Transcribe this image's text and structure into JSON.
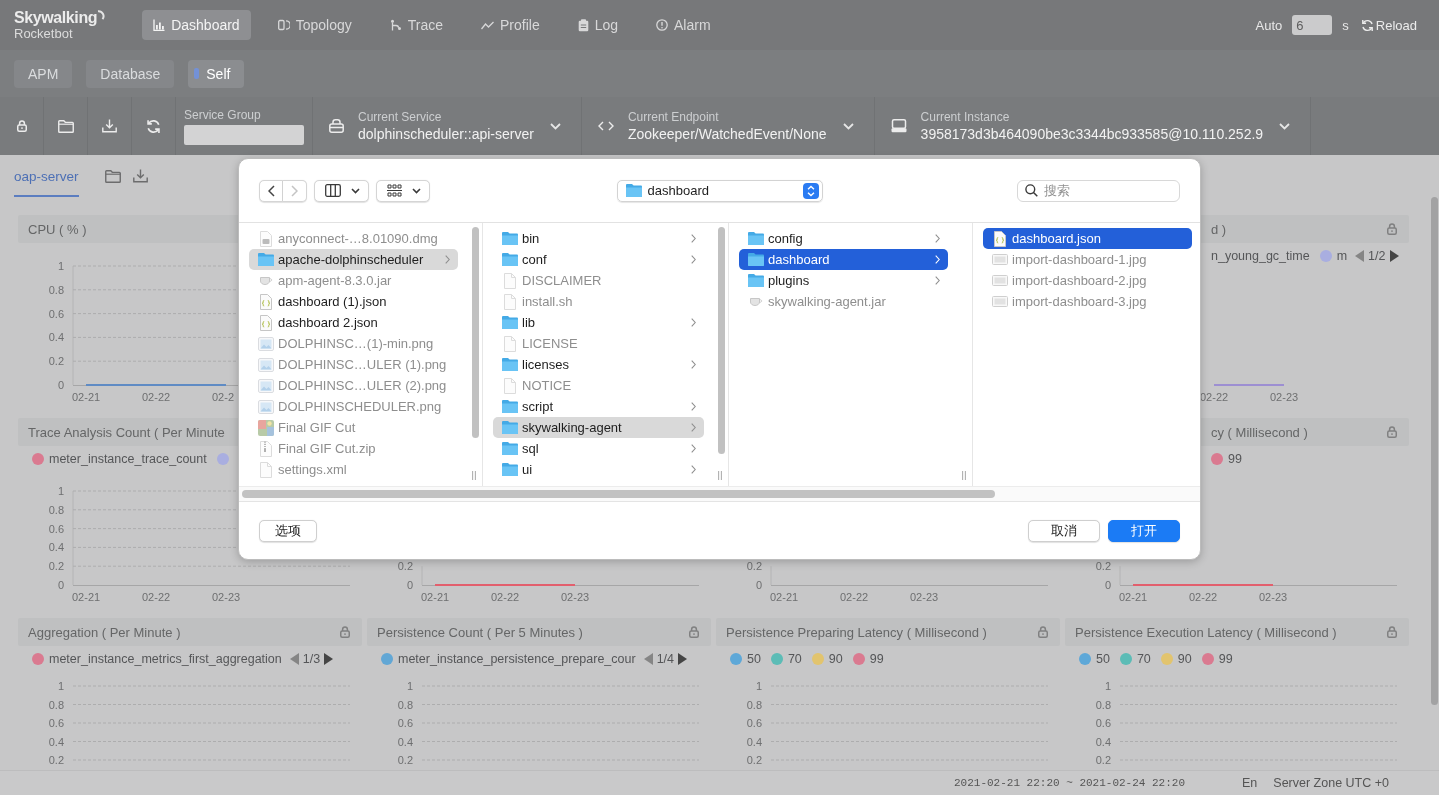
{
  "header": {
    "logo": {
      "title": "Skywalking",
      "subtitle": "Rocketbot"
    },
    "nav": [
      {
        "label": "Dashboard",
        "kind": "dashboard",
        "selected": true
      },
      {
        "label": "Topology",
        "kind": "topology",
        "selected": false
      },
      {
        "label": "Trace",
        "kind": "trace",
        "selected": false
      },
      {
        "label": "Profile",
        "kind": "profile",
        "selected": false
      },
      {
        "label": "Log",
        "kind": "log",
        "selected": false
      },
      {
        "label": "Alarm",
        "kind": "alarm",
        "selected": false
      }
    ],
    "auto_refresh": {
      "label": "Auto",
      "value": "6",
      "unit": "s"
    },
    "reload": "Reload"
  },
  "layers": [
    {
      "label": "APM",
      "selected": false
    },
    {
      "label": "Database",
      "selected": false
    },
    {
      "label": "Self",
      "selected": true
    }
  ],
  "selectors": {
    "service_group": {
      "label": "Service Group"
    },
    "items": [
      {
        "kind": "service",
        "label": "Current Service",
        "value": "dolphinscheduler::api-server"
      },
      {
        "kind": "endpoint",
        "label": "Current Endpoint",
        "value": "Zookeeper/WatchedEvent/None"
      },
      {
        "kind": "instance",
        "label": "Current Instance",
        "value": "3958173d3b464090be3c3344bc933585@10.110.252.9"
      }
    ]
  },
  "tabs": [
    {
      "label": "oap-server",
      "selected": true
    }
  ],
  "dashboard": {
    "rows": [
      [
        {
          "title": "CPU ( % )",
          "chart_data": {
            "type": "line",
            "ylim": [
              0,
              1
            ],
            "yticks": [
              0,
              0.2,
              0.4,
              0.6,
              0.8,
              1
            ],
            "grid": true,
            "categories": [
              "02-21",
              "02-22",
              "02-2"
            ],
            "series": [
              {
                "color": "#5f8bc4",
                "values": [
                  0,
                  0,
                  0
                ]
              }
            ]
          }
        },
        {
          "title": "d )",
          "locked": true,
          "legend": [
            {
              "label": "n_young_gc_time"
            },
            {
              "label": "m",
              "color": "#a9aee0"
            }
          ],
          "pager": "1/2",
          "x_axis_labels": [
            "02-22",
            "02-23"
          ],
          "line": true
        }
      ],
      [
        {
          "title": "Trace Analysis Count ( Per Minute",
          "legend": [
            {
              "label": "meter_instance_trace_count",
              "color": "#da7a90"
            },
            {
              "color": "#a9aee0"
            }
          ],
          "chart_data": {
            "type": "line",
            "ylim": [
              0,
              1
            ],
            "yticks": [
              0,
              0.2,
              0.4,
              0.6,
              0.8,
              1
            ],
            "grid": true,
            "categories": [
              "02-21",
              "02-22",
              "02-23"
            ]
          }
        },
        {
          "chart_data": {
            "type": "line",
            "ylim": [
              0,
              0.2
            ],
            "yticks": [
              0,
              0.2
            ],
            "categories": [
              "02-21",
              "02-22",
              "02-23"
            ],
            "series": [
              {
                "color": "#e25f6d",
                "values": [
                  0,
                  0,
                  0
                ]
              }
            ]
          }
        },
        {
          "chart_data": {
            "type": "line",
            "ylim": [
              0,
              0.2
            ],
            "yticks": [
              0,
              0.2
            ],
            "categories": [
              "02-21",
              "02-22",
              "02-23"
            ]
          }
        },
        {
          "title": "cy ( Millisecond )",
          "locked": true,
          "legend": [
            {
              "label": "99",
              "color": "#da7a90"
            }
          ],
          "chart_data": {
            "type": "line",
            "ylim": [
              0,
              0.2
            ],
            "yticks": [
              0,
              0.2
            ],
            "categories": [
              "02-21",
              "02-22",
              "02-23"
            ],
            "series": [
              {
                "color": "#e25f6d",
                "values": [
                  0,
                  0,
                  0
                ]
              }
            ]
          }
        }
      ],
      [
        {
          "title": "Aggregation ( Per Minute )",
          "locked": true,
          "legend": [
            {
              "label": "meter_instance_metrics_first_aggregation",
              "color": "#da7a90"
            }
          ],
          "pager": "1/3",
          "y_axis_labels": [
            "1",
            "0.8",
            "0.6",
            "0.4",
            "0.2"
          ]
        },
        {
          "title": "Persistence Count ( Per 5 Minutes )",
          "locked": true,
          "legend": [
            {
              "label": "meter_instance_persistence_prepare_cour",
              "color": "#62a7d5"
            }
          ],
          "pager": "1/4",
          "y_axis_labels": [
            "1",
            "0.8",
            "0.6",
            "0.4",
            "0.2"
          ]
        },
        {
          "title": "Persistence Preparing Latency ( Millisecond )",
          "locked": true,
          "legend": [
            {
              "label": "50",
              "color": "#5ea8d8"
            },
            {
              "label": "70",
              "color": "#5cbcb6"
            },
            {
              "label": "90",
              "color": "#e2c46e"
            },
            {
              "label": "99",
              "color": "#da7a90"
            }
          ],
          "y_axis_labels": [
            "1",
            "0.8",
            "0.6",
            "0.4",
            "0.2"
          ]
        },
        {
          "title": "Persistence Execution Latency ( Millisecond )",
          "locked": true,
          "legend": [
            {
              "label": "50",
              "color": "#5ea8d8"
            },
            {
              "label": "70",
              "color": "#5cbcb6"
            },
            {
              "label": "90",
              "color": "#e2c46e"
            },
            {
              "label": "99",
              "color": "#da7a90"
            }
          ],
          "y_axis_labels": [
            "1",
            "0.8",
            "0.6",
            "0.4",
            "0.2"
          ]
        }
      ]
    ]
  },
  "footer": {
    "time_range": "2021-02-21 22:20 ~ 2021-02-24 22:20",
    "language": "En",
    "server_zone": "Server Zone UTC +0"
  },
  "dialog": {
    "back": {
      "disabled": false
    },
    "forward": {
      "disabled": true
    },
    "location": "dashboard",
    "search": {
      "placeholder": "搜索"
    },
    "columns": [
      {
        "active": false,
        "items": [
          {
            "name": "anyconnect-…8.01090.dmg",
            "kind": "disk-image",
            "disabled": true,
            "selected": false
          },
          {
            "name": "apache-dolphinscheduler",
            "kind": "folder",
            "disabled": false,
            "selected": true
          },
          {
            "name": "apm-agent-8.3.0.jar",
            "kind": "jar",
            "disabled": true,
            "selected": false
          },
          {
            "name": "dashboard (1).json",
            "kind": "json",
            "disabled": false,
            "selected": false
          },
          {
            "name": "dashboard 2.json",
            "kind": "json",
            "disabled": false,
            "selected": false
          },
          {
            "name": "DOLPHINSC…(1)-min.png",
            "kind": "image",
            "disabled": true,
            "selected": false
          },
          {
            "name": "DOLPHINSC…ULER (1).png",
            "kind": "image",
            "disabled": true,
            "selected": false
          },
          {
            "name": "DOLPHINSC…ULER (2).png",
            "kind": "image",
            "disabled": true,
            "selected": false
          },
          {
            "name": "DOLPHINSCHEDULER.png",
            "kind": "image",
            "disabled": true,
            "selected": false
          },
          {
            "name": "Final GIF Cut",
            "kind": "gif",
            "disabled": true,
            "selected": false
          },
          {
            "name": "Final GIF Cut.zip",
            "kind": "zip",
            "disabled": true,
            "selected": false
          },
          {
            "name": "settings.xml",
            "kind": "document",
            "disabled": true,
            "selected": false
          }
        ]
      },
      {
        "active": false,
        "items": [
          {
            "name": "bin",
            "kind": "folder",
            "disabled": false,
            "selected": false
          },
          {
            "name": "conf",
            "kind": "folder",
            "disabled": false,
            "selected": false
          },
          {
            "name": "DISCLAIMER",
            "kind": "document",
            "disabled": true,
            "selected": false
          },
          {
            "name": "install.sh",
            "kind": "document",
            "disabled": true,
            "selected": false
          },
          {
            "name": "lib",
            "kind": "folder",
            "disabled": false,
            "selected": false
          },
          {
            "name": "LICENSE",
            "kind": "document",
            "disabled": true,
            "selected": false
          },
          {
            "name": "licenses",
            "kind": "folder",
            "disabled": false,
            "selected": false
          },
          {
            "name": "NOTICE",
            "kind": "document",
            "disabled": true,
            "selected": false
          },
          {
            "name": "script",
            "kind": "folder",
            "disabled": false,
            "selected": false
          },
          {
            "name": "skywalking-agent",
            "kind": "folder",
            "disabled": false,
            "selected": true
          },
          {
            "name": "sql",
            "kind": "folder",
            "disabled": false,
            "selected": false
          },
          {
            "name": "ui",
            "kind": "folder",
            "disabled": false,
            "selected": false
          }
        ]
      },
      {
        "active": true,
        "items": [
          {
            "name": "config",
            "kind": "folder",
            "disabled": false,
            "selected": false
          },
          {
            "name": "dashboard",
            "kind": "folder",
            "disabled": false,
            "selected": true
          },
          {
            "name": "plugins",
            "kind": "folder",
            "disabled": false,
            "selected": false
          },
          {
            "name": "skywalking-agent.jar",
            "kind": "jar",
            "disabled": true,
            "selected": false
          }
        ]
      },
      {
        "active": true,
        "items": [
          {
            "name": "dashboard.json",
            "kind": "json",
            "disabled": false,
            "selected": true
          },
          {
            "name": "import-dashboard-1.jpg",
            "kind": "photo",
            "disabled": true,
            "selected": false
          },
          {
            "name": "import-dashboard-2.jpg",
            "kind": "photo",
            "disabled": true,
            "selected": false
          },
          {
            "name": "import-dashboard-3.jpg",
            "kind": "photo",
            "disabled": true,
            "selected": false
          }
        ]
      }
    ],
    "options_button": "选项",
    "buttons": [
      {
        "label": "取消",
        "primary": false
      },
      {
        "label": "打开",
        "primary": true
      }
    ]
  }
}
